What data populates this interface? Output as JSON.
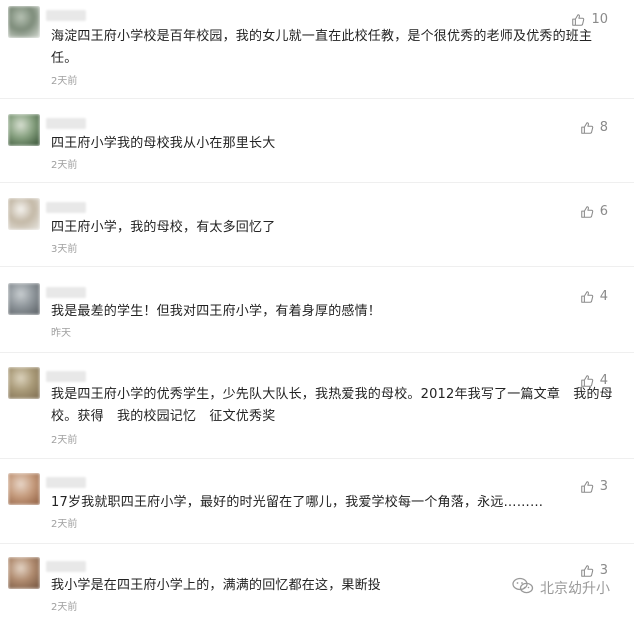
{
  "comments": [
    {
      "avatar_colors": [
        "#d8ddd6",
        "#7c8b79",
        "#b7c2b4"
      ],
      "likes": "10",
      "text": "海淀四王府小学校是百年校园，我的女儿就一直在此校任教，是个很优秀的老师及优秀的班主任。",
      "time": "2天前"
    },
    {
      "avatar_colors": [
        "#2f4b2e",
        "#86a07f",
        "#d8e0d2"
      ],
      "likes": "8",
      "text": "四王府小学我的母校我从小在那里长大",
      "time": "2天前"
    },
    {
      "avatar_colors": [
        "#e9e7e2",
        "#c3b8a6",
        "#f5f3ef"
      ],
      "likes": "6",
      "text": "四王府小学，我的母校，有太多回忆了",
      "time": "3天前"
    },
    {
      "avatar_colors": [
        "#555b60",
        "#8f969b",
        "#c9ced1"
      ],
      "likes": "4",
      "text": "我是最差的学生！但我对四王府小学，有着身厚的感情！",
      "time": "昨天"
    },
    {
      "avatar_colors": [
        "#7b6a4e",
        "#a99a78",
        "#dcd3bd"
      ],
      "likes": "4",
      "text": "我是四王府小学的优秀学生，少先队大队长，我热爱我的母校。2012年我写了一篇文章　我的母校。获得　我的校园记忆　征文优秀奖",
      "time": "2天前"
    },
    {
      "avatar_colors": [
        "#8c5a3c",
        "#c59b7d",
        "#e8d6c8"
      ],
      "likes": "3",
      "text": "17岁我就职四王府小学，最好的时光留在了哪儿，我爱学校每一个角落，永远………",
      "time": "2天前"
    },
    {
      "avatar_colors": [
        "#6e4f3a",
        "#b08b6f",
        "#e4d4c5"
      ],
      "likes": "3",
      "text": "我小学是在四王府小学上的，满满的回忆都在这，果断投",
      "time": "2天前"
    }
  ],
  "watermark": {
    "text": "北京幼升小",
    "icon": "wechat-icon"
  },
  "colors": {
    "like_gray": "#8a8a8a",
    "text": "#222222",
    "time": "#a0a0a0"
  }
}
